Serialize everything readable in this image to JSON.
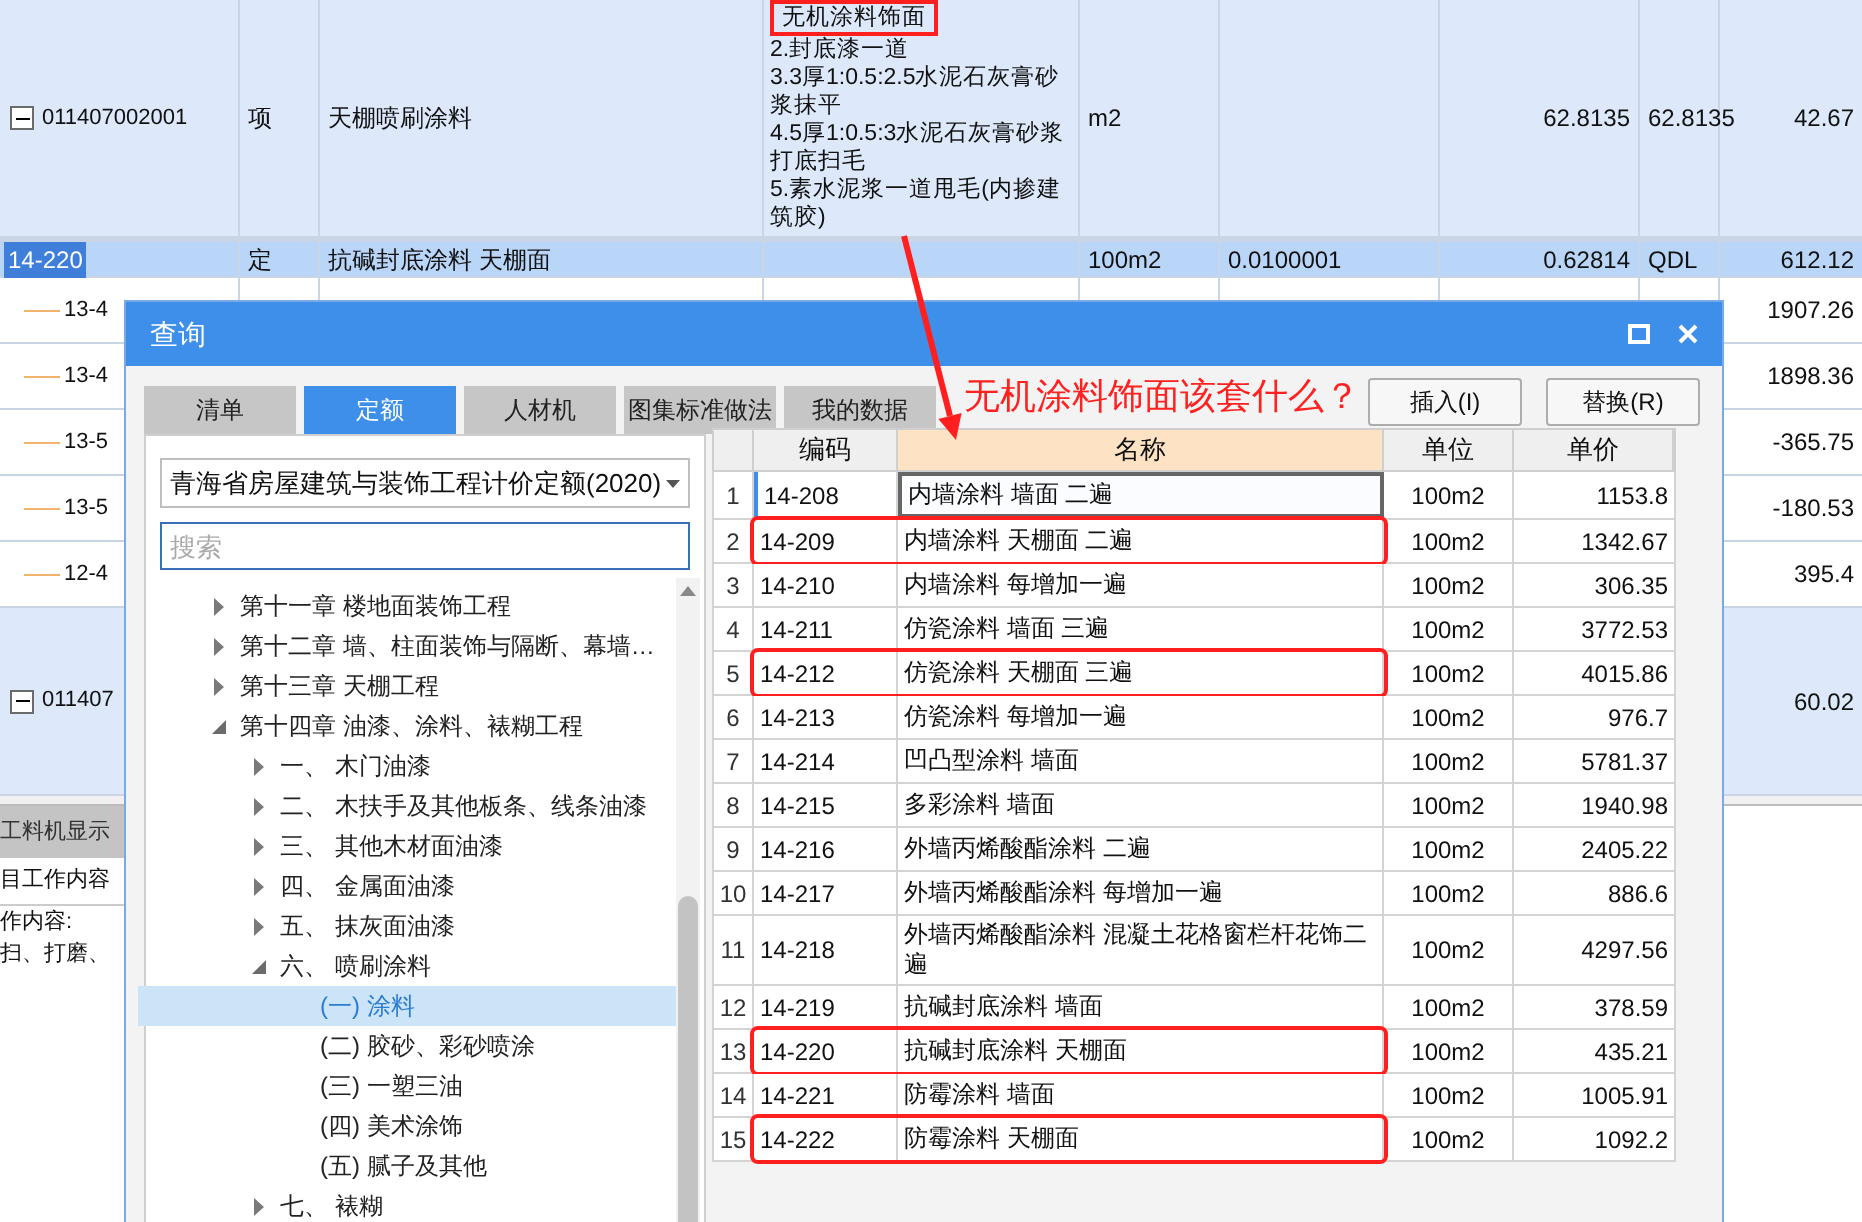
{
  "sheet": {
    "rows": [
      {
        "kind": "item",
        "expanded": true,
        "selected": false,
        "code": "011407002001",
        "type": "项",
        "name": "天棚喷刷涂料",
        "features": [
          {
            "text": "无机涂料饰面",
            "highlighted": true
          },
          {
            "text": "2.封底漆一道",
            "highlighted": false
          },
          {
            "text": "3.3厚1:0.5:2.5水泥石灰膏砂浆抹平",
            "highlighted": false
          },
          {
            "text": "4.5厚1:0.5:3水泥石灰膏砂浆打底扫毛",
            "highlighted": false
          },
          {
            "text": "5.素水泥浆一道甩毛(内掺建筑胶)",
            "highlighted": false
          }
        ],
        "unit": "m2",
        "quantity": "62.8135",
        "quantity_expr": "62.8135",
        "price": "42.67"
      },
      {
        "kind": "quota",
        "selected": true,
        "code": "14-220",
        "type": "定",
        "name": "抗碱封底涂料 天棚面",
        "unit": "100m2",
        "coefficient": "0.0100001",
        "quantity": "0.62814",
        "quantity_expr": "QDL",
        "price": "612.12"
      },
      {
        "kind": "sub",
        "selected": false,
        "code": "13-4",
        "price": "1907.26"
      },
      {
        "kind": "sub",
        "selected": false,
        "code": "13-4",
        "price": "1898.36"
      },
      {
        "kind": "sub",
        "selected": false,
        "code": "13-5",
        "price": "-365.75"
      },
      {
        "kind": "sub",
        "selected": false,
        "code": "13-5",
        "price": "-180.53"
      },
      {
        "kind": "sub",
        "selected": false,
        "code": "12-4",
        "price": "395.4"
      },
      {
        "kind": "item",
        "expanded": true,
        "selected": false,
        "code": "011407",
        "price": "60.02"
      }
    ]
  },
  "bottom_panel": {
    "tab": "工料机显示",
    "heading": "目工作内容",
    "lines": [
      "作内容:",
      "扫、打磨、"
    ]
  },
  "annotation": {
    "text": "无机涂料饰面该套什么？"
  },
  "dialog": {
    "title": "查询",
    "tabs": [
      {
        "label": "清单",
        "selected": false
      },
      {
        "label": "定额",
        "selected": true
      },
      {
        "label": "人材机",
        "selected": false
      },
      {
        "label": "图集标准做法",
        "selected": false
      },
      {
        "label": "我的数据",
        "selected": false
      }
    ],
    "buttons": [
      "插入(I)",
      "替换(R)"
    ],
    "library": "青海省房屋建筑与装饰工程计价定额(2020)",
    "search": {
      "placeholder": "搜索"
    },
    "tree": [
      {
        "kind": "branch",
        "label": "第十一章 楼地面装饰工程",
        "expanded": false,
        "selected": false
      },
      {
        "kind": "branch",
        "label": "第十二章 墙、柱面装饰与隔断、幕墙…",
        "expanded": false,
        "selected": false
      },
      {
        "kind": "branch",
        "label": "第十三章 天棚工程",
        "expanded": false,
        "selected": false
      },
      {
        "kind": "branch",
        "label": "第十四章 油漆、涂料、裱糊工程",
        "expanded": true,
        "selected": false,
        "children": [
          {
            "kind": "branch",
            "label": "一、 木门油漆",
            "expanded": false,
            "selected": false
          },
          {
            "kind": "branch",
            "label": "二、 木扶手及其他板条、线条油漆",
            "expanded": false,
            "selected": false
          },
          {
            "kind": "branch",
            "label": "三、 其他木材面油漆",
            "expanded": false,
            "selected": false
          },
          {
            "kind": "branch",
            "label": "四、 金属面油漆",
            "expanded": false,
            "selected": false
          },
          {
            "kind": "branch",
            "label": "五、 抹灰面油漆",
            "expanded": false,
            "selected": false
          },
          {
            "kind": "branch",
            "label": "六、 喷刷涂料",
            "expanded": true,
            "selected": false,
            "children": [
              {
                "kind": "leaf",
                "label": "(一) 涂料",
                "selected": true
              },
              {
                "kind": "leaf",
                "label": "(二) 胶砂、彩砂喷涂",
                "selected": false
              },
              {
                "kind": "leaf",
                "label": "(三) 一塑三油",
                "selected": false
              },
              {
                "kind": "leaf",
                "label": "(四) 美术涂饰",
                "selected": false
              },
              {
                "kind": "leaf",
                "label": "(五) 腻子及其他",
                "selected": false
              }
            ]
          },
          {
            "kind": "branch",
            "label": "七、 裱糊",
            "expanded": false,
            "selected": false
          }
        ]
      }
    ],
    "table": {
      "columns": [
        "编码",
        "名称",
        "单位",
        "单价"
      ],
      "rows": [
        {
          "index": "1",
          "code": "14-208",
          "name": "内墙涂料 墙面 二遍",
          "unit": "100m2",
          "price": "1153.8",
          "selected": true,
          "highlighted": false
        },
        {
          "index": "2",
          "code": "14-209",
          "name": "内墙涂料 天棚面 二遍",
          "unit": "100m2",
          "price": "1342.67",
          "selected": false,
          "highlighted": true
        },
        {
          "index": "3",
          "code": "14-210",
          "name": "内墙涂料 每增加一遍",
          "unit": "100m2",
          "price": "306.35",
          "selected": false,
          "highlighted": false
        },
        {
          "index": "4",
          "code": "14-211",
          "name": "仿瓷涂料 墙面 三遍",
          "unit": "100m2",
          "price": "3772.53",
          "selected": false,
          "highlighted": false
        },
        {
          "index": "5",
          "code": "14-212",
          "name": "仿瓷涂料 天棚面 三遍",
          "unit": "100m2",
          "price": "4015.86",
          "selected": false,
          "highlighted": true
        },
        {
          "index": "6",
          "code": "14-213",
          "name": "仿瓷涂料 每增加一遍",
          "unit": "100m2",
          "price": "976.7",
          "selected": false,
          "highlighted": false
        },
        {
          "index": "7",
          "code": "14-214",
          "name": "凹凸型涂料 墙面",
          "unit": "100m2",
          "price": "5781.37",
          "selected": false,
          "highlighted": false
        },
        {
          "index": "8",
          "code": "14-215",
          "name": "多彩涂料 墙面",
          "unit": "100m2",
          "price": "1940.98",
          "selected": false,
          "highlighted": false
        },
        {
          "index": "9",
          "code": "14-216",
          "name": "外墙丙烯酸酯涂料 二遍",
          "unit": "100m2",
          "price": "2405.22",
          "selected": false,
          "highlighted": false
        },
        {
          "index": "10",
          "code": "14-217",
          "name": "外墙丙烯酸酯涂料 每增加一遍",
          "unit": "100m2",
          "price": "886.6",
          "selected": false,
          "highlighted": false
        },
        {
          "index": "11",
          "code": "14-218",
          "name": "外墙丙烯酸酯涂料 混凝土花格窗栏杆花饰二遍",
          "unit": "100m2",
          "price": "4297.56",
          "selected": false,
          "highlighted": false
        },
        {
          "index": "12",
          "code": "14-219",
          "name": "抗碱封底涂料 墙面",
          "unit": "100m2",
          "price": "378.59",
          "selected": false,
          "highlighted": false
        },
        {
          "index": "13",
          "code": "14-220",
          "name": "抗碱封底涂料 天棚面",
          "unit": "100m2",
          "price": "435.21",
          "selected": false,
          "highlighted": true
        },
        {
          "index": "14",
          "code": "14-221",
          "name": "防霉涂料 墙面",
          "unit": "100m2",
          "price": "1005.91",
          "selected": false,
          "highlighted": false
        },
        {
          "index": "15",
          "code": "14-222",
          "name": "防霉涂料 天棚面",
          "unit": "100m2",
          "price": "1092.2",
          "selected": false,
          "highlighted": true
        }
      ]
    }
  }
}
